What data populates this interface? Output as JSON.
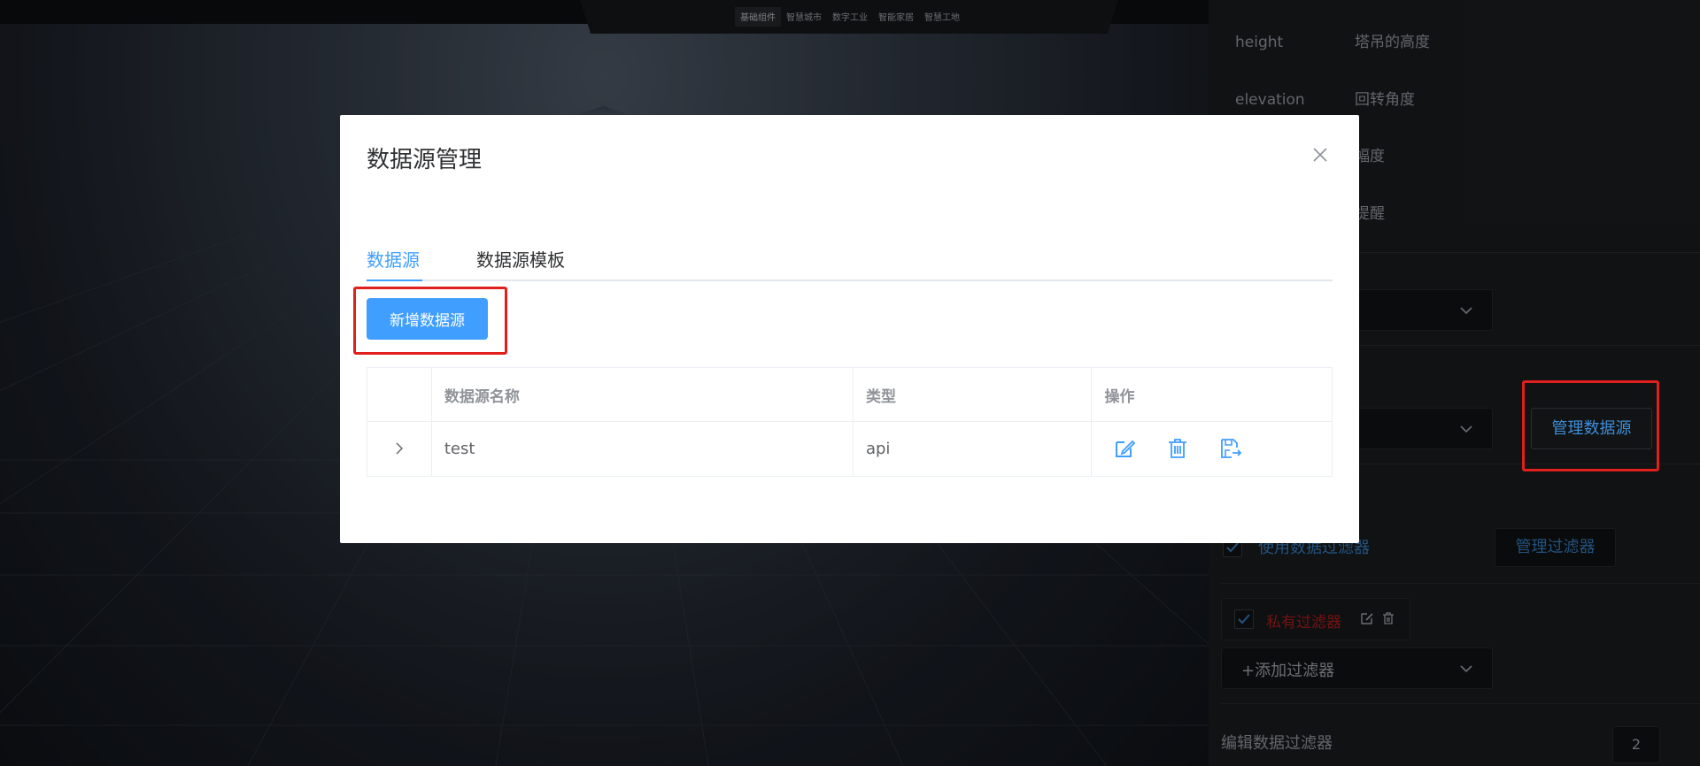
{
  "topnav": {
    "items": [
      "基础组件",
      "智慧城市",
      "数字工业",
      "智能家居",
      "智慧工地"
    ],
    "active_index": 0
  },
  "panel": {
    "props": [
      {
        "key": "height",
        "value": "塔吊的高度"
      },
      {
        "key": "elevation",
        "value": "回转角度"
      },
      {
        "key": "",
        "value": "幅度"
      },
      {
        "key": "",
        "value": "提醒"
      }
    ],
    "manage_datasource_label": "管理数据源",
    "use_filter_label": "使用数据过滤器",
    "manage_filter_label": "管理过滤器",
    "private_filter_label": "私有过滤器",
    "add_filter_label": "+添加过滤器",
    "edit_filter_label": "编辑数据过滤器",
    "counter": "2"
  },
  "modal": {
    "title": "数据源管理",
    "tabs": [
      {
        "label": "数据源",
        "active": true
      },
      {
        "label": "数据源模板",
        "active": false
      }
    ],
    "add_button_label": "新增数据源",
    "table": {
      "headers": [
        "数据源名称",
        "类型",
        "操作"
      ],
      "rows": [
        {
          "name": "test",
          "type": "api",
          "actions": [
            "edit-icon",
            "delete-icon",
            "export-icon"
          ]
        }
      ]
    }
  },
  "colors": {
    "accent": "#409eff",
    "highlight": "#e0201c",
    "panel_bg": "#1d2023",
    "private_filter_text": "#c8201e"
  }
}
